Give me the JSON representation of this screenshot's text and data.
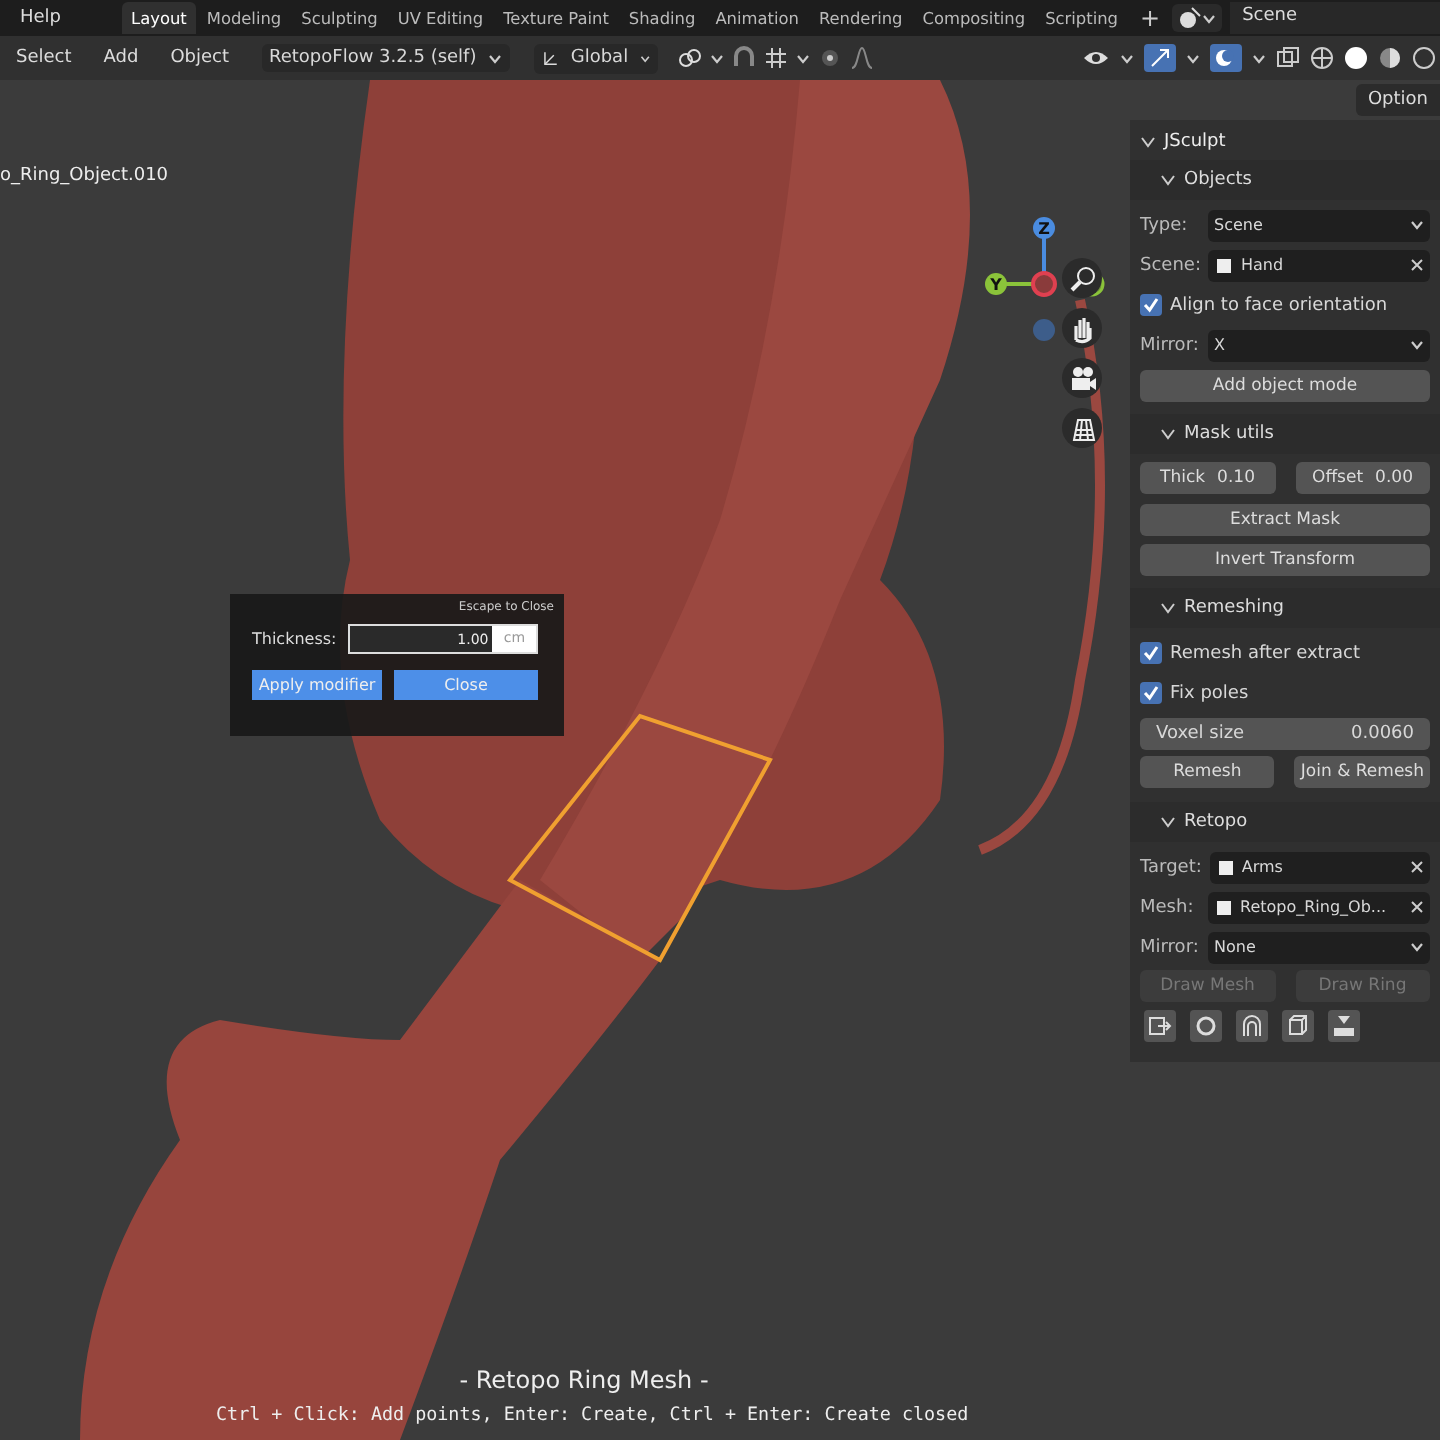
{
  "topbar": {
    "menu": "Help",
    "workspaces": [
      {
        "label": "Layout",
        "selected": true
      },
      {
        "label": "Modeling",
        "selected": false
      },
      {
        "label": "Sculpting",
        "selected": false
      },
      {
        "label": "UV Editing",
        "selected": false
      },
      {
        "label": "Texture Paint",
        "selected": false
      },
      {
        "label": "Shading",
        "selected": false
      },
      {
        "label": "Animation",
        "selected": false
      },
      {
        "label": "Rendering",
        "selected": false
      },
      {
        "label": "Compositing",
        "selected": false
      },
      {
        "label": "Scripting",
        "selected": false
      }
    ],
    "add_tab": "+",
    "scene": "Scene"
  },
  "header": {
    "menus": [
      "Select",
      "Add",
      "Object"
    ],
    "mode": "RetopoFlow 3.2.5 (self)",
    "orientation": "Global",
    "options_tab": "Option"
  },
  "viewport": {
    "object_name": "o_Ring_Object.010",
    "gizmo": {
      "z": "Z",
      "y": "Y"
    },
    "dialog": {
      "hint": "Escape to Close",
      "label": "Thickness:",
      "value": "1.00",
      "unit": "cm",
      "buttons": [
        "Apply modifier",
        "Close"
      ]
    },
    "footer_title": "- Retopo Ring Mesh -",
    "footer_hint": "Ctrl + Click: Add points, Enter: Create, Ctrl + Enter: Create closed"
  },
  "panel": {
    "title": "JSculpt",
    "expanded": true,
    "sections": [
      {
        "title": "Objects",
        "expanded": true,
        "rows": [
          {
            "kind": "dropdown",
            "label": "Type:",
            "value": "Scene"
          },
          {
            "kind": "object",
            "label": "Scene:",
            "value": "Hand"
          },
          {
            "kind": "checkbox",
            "label": "Align to face orientation",
            "checked": true
          },
          {
            "kind": "dropdown",
            "label": "Mirror:",
            "value": "X"
          },
          {
            "kind": "button",
            "label": "Add object mode",
            "disabled": false
          }
        ]
      },
      {
        "title": "Mask utils",
        "expanded": true,
        "rows": [
          {
            "kind": "pair",
            "items": [
              {
                "kind": "number",
                "label": "Thick",
                "value": "0.10"
              },
              {
                "kind": "number",
                "label": "Offset",
                "value": "0.00"
              }
            ]
          },
          {
            "kind": "button",
            "label": "Extract Mask",
            "disabled": false
          },
          {
            "kind": "button",
            "label": "Invert Transform",
            "disabled": false
          }
        ]
      },
      {
        "title": "Remeshing",
        "expanded": true,
        "rows": [
          {
            "kind": "checkbox",
            "label": "Remesh after extract",
            "checked": true
          },
          {
            "kind": "checkbox",
            "label": "Fix poles",
            "checked": true
          },
          {
            "kind": "slider",
            "label": "Voxel size",
            "value": "0.0060"
          },
          {
            "kind": "pair",
            "items": [
              {
                "kind": "button",
                "label": "Remesh",
                "disabled": false
              },
              {
                "kind": "button",
                "label": "Join & Remesh",
                "disabled": false
              }
            ]
          }
        ]
      },
      {
        "title": "Retopo",
        "expanded": true,
        "rows": [
          {
            "kind": "object",
            "label": "Target:",
            "value": "Arms"
          },
          {
            "kind": "object",
            "label": "Mesh:",
            "value": "Retopo_Ring_Ob..."
          },
          {
            "kind": "dropdown",
            "label": "Mirror:",
            "value": "None"
          },
          {
            "kind": "pair",
            "items": [
              {
                "kind": "button",
                "label": "Draw Mesh",
                "disabled": true
              },
              {
                "kind": "button",
                "label": "Draw Ring",
                "disabled": true
              }
            ]
          },
          {
            "kind": "icons"
          }
        ]
      }
    ]
  }
}
